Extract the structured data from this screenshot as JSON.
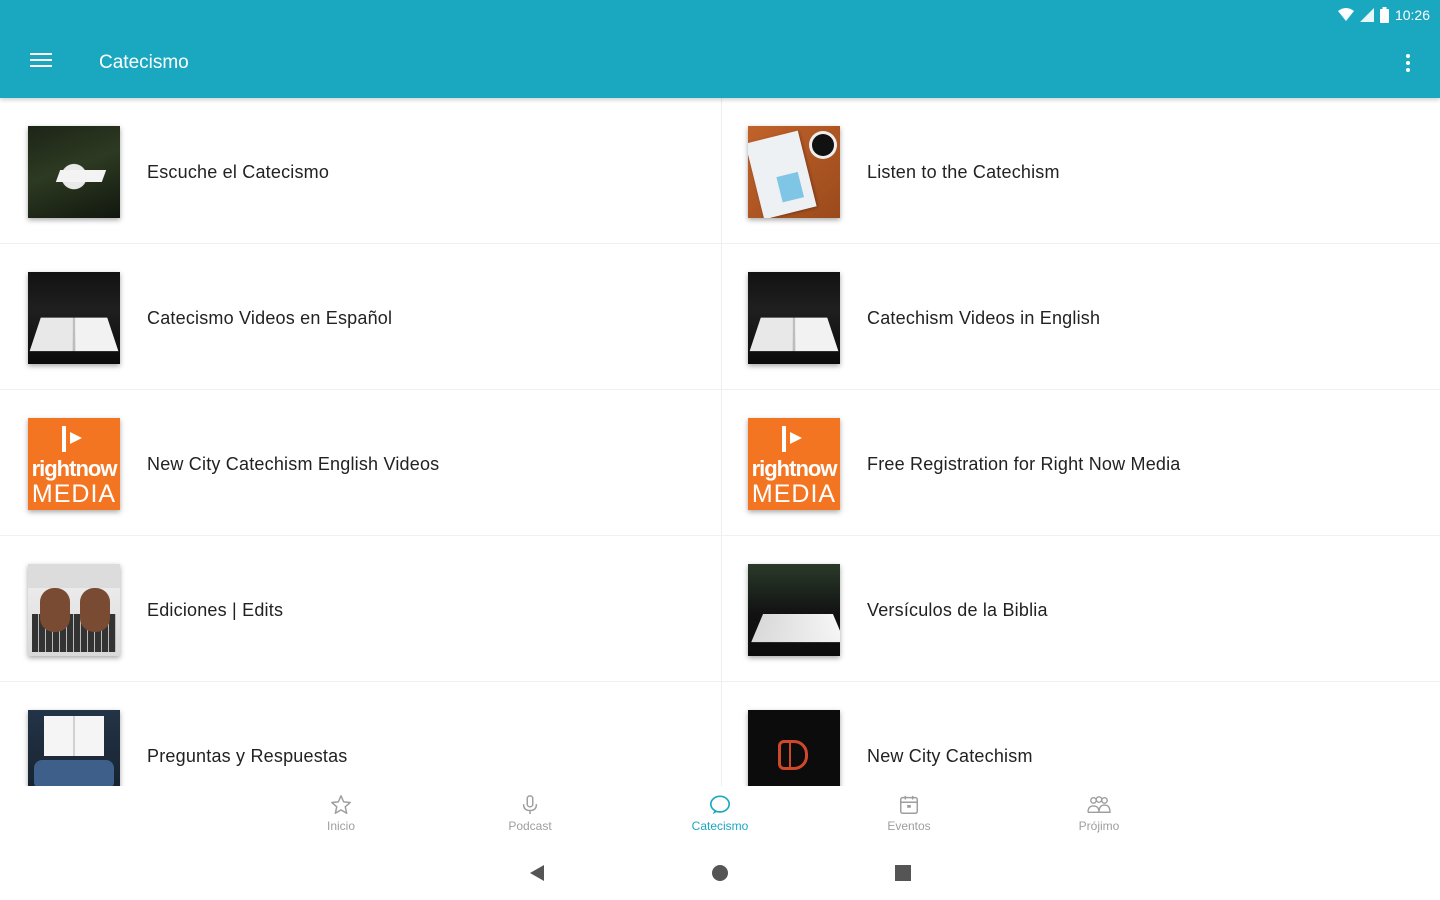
{
  "status_bar": {
    "time": "10:26"
  },
  "app_bar": {
    "title": "Catecismo"
  },
  "items": [
    {
      "label": "Escuche el Catecismo",
      "thumb": "forest-book"
    },
    {
      "label": "Listen to the Catechism",
      "thumb": "desk-booklet"
    },
    {
      "label": "Catecismo Videos en Español",
      "thumb": "open-bible"
    },
    {
      "label": "Catechism Videos in English",
      "thumb": "open-bible"
    },
    {
      "label": "New City Catechism English Videos",
      "thumb": "rightnow-media",
      "logo_text": [
        "rightnow",
        "MEDIA"
      ]
    },
    {
      "label": "Free Registration for Right Now Media",
      "thumb": "rightnow-media",
      "logo_text": [
        "rightnow",
        "MEDIA"
      ]
    },
    {
      "label": "Ediciones | Edits",
      "thumb": "laptop-typing"
    },
    {
      "label": "Versículos de la Biblia",
      "thumb": "bible-outdoors"
    },
    {
      "label": "Preguntas y Respuestas",
      "thumb": "reading-book"
    },
    {
      "label": "New City Catechism",
      "thumb": "ncc-logo"
    }
  ],
  "bottom_nav": {
    "items": [
      {
        "label": "Inicio",
        "icon": "star-icon"
      },
      {
        "label": "Podcast",
        "icon": "microphone-icon"
      },
      {
        "label": "Catecismo",
        "icon": "chat-bubble-icon",
        "active": true
      },
      {
        "label": "Eventos",
        "icon": "calendar-icon"
      },
      {
        "label": "Prójimo",
        "icon": "people-icon"
      }
    ]
  },
  "colors": {
    "primary": "#1aa8c1",
    "rightnow_orange": "#f47521",
    "inactive": "#9e9e9e"
  }
}
